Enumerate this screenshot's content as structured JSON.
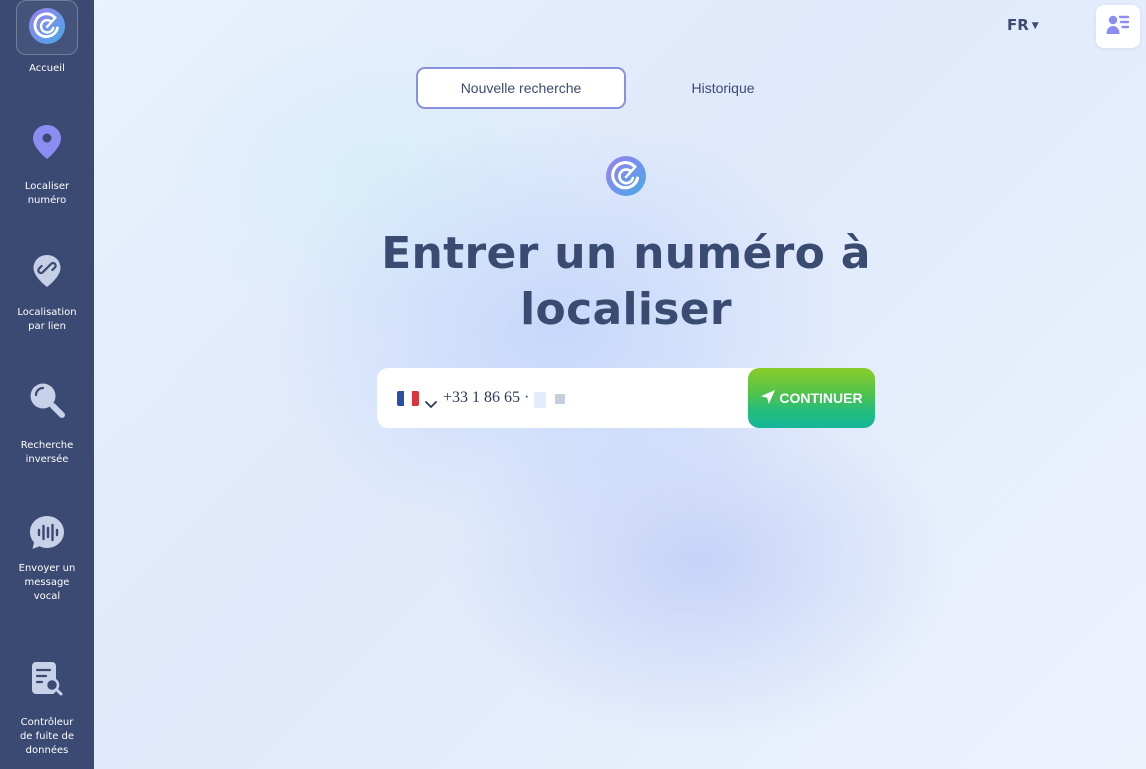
{
  "sidebar": {
    "items": [
      {
        "label": "Accueil",
        "icon": "radar-logo-icon"
      },
      {
        "label": "Localiser\nnuméro",
        "icon": "location-pin-icon"
      },
      {
        "label": "Localisation\npar lien",
        "icon": "link-pin-icon"
      },
      {
        "label": "Recherche\ninversée",
        "icon": "magnifier-icon"
      },
      {
        "label": "Envoyer un\nmessage\nvocal",
        "icon": "voice-message-icon"
      },
      {
        "label": "Contrôleur\nde fuite de\ndonnées",
        "icon": "document-search-icon"
      }
    ]
  },
  "header": {
    "language": "FR",
    "profile_icon": "user-list-icon"
  },
  "tabs": [
    {
      "label": "Nouvelle recherche",
      "active": true
    },
    {
      "label": "Historique",
      "active": false
    }
  ],
  "main": {
    "heading": "Entrer un numéro à localiser",
    "phone": {
      "country": "FR",
      "value": "+33 1 86 65 ·"
    },
    "continue_label": "CONTINUER"
  },
  "colors": {
    "sidebar_bg": "#3a4a72",
    "accent_purple": "#8a8fe0",
    "heading": "#3a4b72",
    "button_green_top": "#8ccd28",
    "button_green_bottom": "#16b59c",
    "flag_blue": "#2a4fa3",
    "flag_red": "#d8353c"
  }
}
